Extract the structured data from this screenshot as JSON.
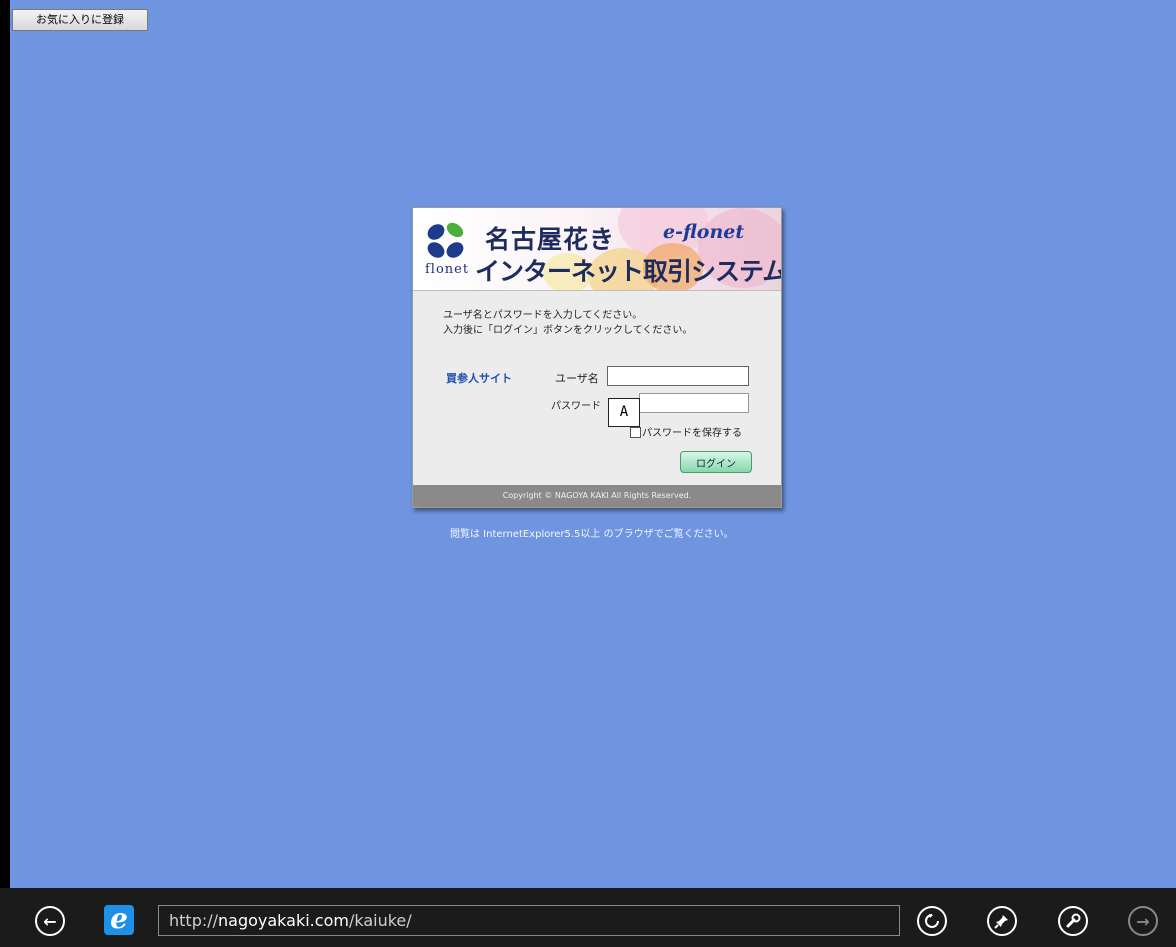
{
  "favorites_button": {
    "label": "お気に入りに登録"
  },
  "login_card": {
    "banner": {
      "logo_text": "flonet",
      "title_line1": "名古屋花き",
      "brand": "e-flonet",
      "title_line2": "インターネット取引システム"
    },
    "instructions": [
      "ユーザ名とパスワードを入力してください。",
      "入力後に「ログイン」ボタンをクリックしてください。"
    ],
    "site_label": "買参人サイト",
    "username_label": "ユーザ名",
    "username_value": "",
    "password_label": "パスワード",
    "password_value": "",
    "marker": "A",
    "save_password_label": "パスワードを保存する",
    "save_password_checked": false,
    "login_button": "ログイン",
    "copyright": "Copyright © NAGOYA KAKI All Rights Reserved."
  },
  "browser_note": "閲覧は InternetExplorer5.5以上 のブラウザでご覧ください。",
  "taskbar": {
    "url_prefix": "http://",
    "url_domain": "nagoyakaki.com",
    "url_path": "/kaiuke/",
    "icons": {
      "back": "back-arrow-icon",
      "browser": "internet-explorer-icon",
      "refresh": "refresh-icon",
      "pin": "pin-icon",
      "tools": "wrench-icon",
      "forward": "forward-arrow-icon"
    }
  },
  "colors": {
    "page_background": "#6f95e0",
    "taskbar": "#1b1b1b",
    "login_button": "#86d8ac",
    "site_label": "#1f4fb0"
  }
}
